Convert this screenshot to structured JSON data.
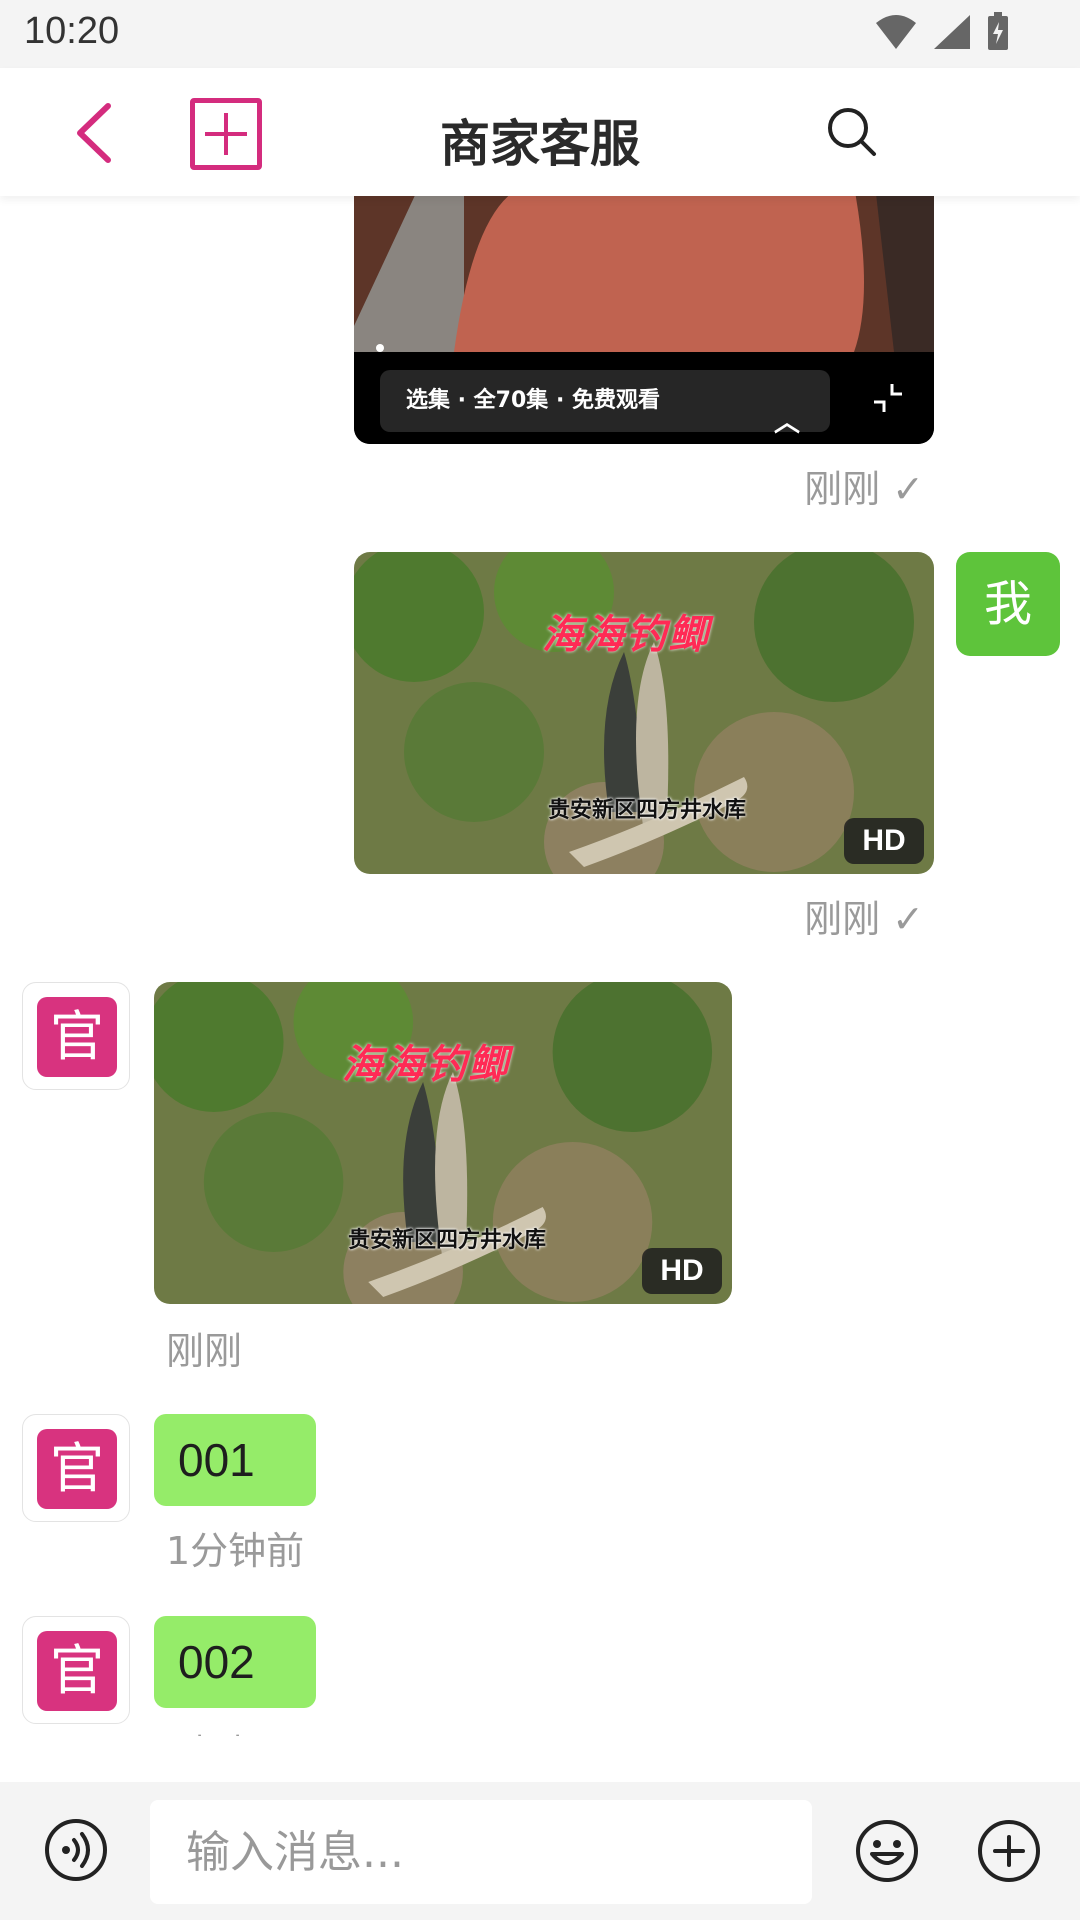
{
  "status_bar": {
    "time": "10:20"
  },
  "header": {
    "title": "商家客服"
  },
  "messages": {
    "first_video": {
      "episode_label": "选集 · 全70集 · 免费观看",
      "meta": "刚刚 ✓"
    },
    "second_video": {
      "title": "海海钓鲫",
      "caption": "贵安新区四方井水库",
      "badge": "HD",
      "meta": "刚刚 ✓",
      "avatar": "我"
    },
    "third_video": {
      "title": "海海钓鲫",
      "caption": "贵安新区四方井水库",
      "badge": "HD",
      "meta": "刚刚",
      "avatar": "官"
    },
    "text1": {
      "text": "001",
      "meta": "1分钟前",
      "avatar": "官"
    },
    "text2": {
      "text": "002",
      "meta": "刚刚",
      "avatar": "官"
    }
  },
  "input": {
    "placeholder": "输入消息..."
  },
  "colors": {
    "accent": "#d42c7e",
    "bubble": "#95ec69",
    "me_avatar": "#5ec43b",
    "official_avatar": "#d8337f"
  },
  "icons": [
    "back-icon",
    "add-icon",
    "search-icon",
    "voice-icon",
    "emoji-icon",
    "plus-icon",
    "collapse-icon",
    "chevron-up-icon",
    "wifi-icon",
    "signal-icon",
    "battery-icon"
  ]
}
